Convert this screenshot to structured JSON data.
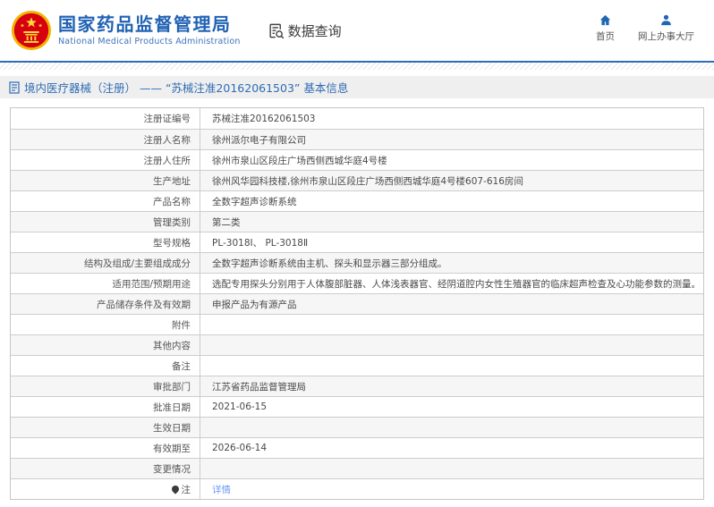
{
  "header": {
    "title": "国家药品监督管理局",
    "subtitle": "National Medical Products Administration",
    "data_query": "数据查询",
    "nav": [
      {
        "label": "首页",
        "icon": "home-icon"
      },
      {
        "label": "网上办事大厅",
        "icon": "person-icon"
      }
    ]
  },
  "breadcrumb": {
    "text": "境内医疗器械（注册） ——  “苏械注准20162061503”  基本信息",
    "icon": "document-icon"
  },
  "table": {
    "rows": [
      {
        "label": "注册证编号",
        "value": "苏械注准20162061503"
      },
      {
        "label": "注册人名称",
        "value": "徐州派尔电子有限公司"
      },
      {
        "label": "注册人住所",
        "value": "徐州市泉山区段庄广场西侧西城华庭4号楼"
      },
      {
        "label": "生产地址",
        "value": "徐州风华园科技楼,徐州市泉山区段庄广场西侧西城华庭4号楼607-616房间"
      },
      {
        "label": "产品名称",
        "value": "全数字超声诊断系统"
      },
      {
        "label": "管理类别",
        "value": "第二类"
      },
      {
        "label": "型号规格",
        "value": "PL-3018Ⅰ、 PL-3018Ⅱ"
      },
      {
        "label": "结构及组成/主要组成成分",
        "value": "全数字超声诊断系统由主机、探头和显示器三部分组成。"
      },
      {
        "label": "适用范围/预期用途",
        "value": "选配专用探头分别用于人体腹部脏器、人体浅表器官、经阴道腔内女性生殖器官的临床超声检查及心功能参数的测量。"
      },
      {
        "label": "产品储存条件及有效期",
        "value": "申报产品为有源产品"
      },
      {
        "label": "附件",
        "value": ""
      },
      {
        "label": "其他内容",
        "value": ""
      },
      {
        "label": "备注",
        "value": ""
      },
      {
        "label": "审批部门",
        "value": "江苏省药品监督管理局"
      },
      {
        "label": "批准日期",
        "value": "2021-06-15"
      },
      {
        "label": "生效日期",
        "value": ""
      },
      {
        "label": "有效期至",
        "value": "2026-06-14"
      },
      {
        "label": "变更情况",
        "value": ""
      },
      {
        "label": "注",
        "value": "详情",
        "label_icon": "note-pin-icon",
        "value_link": true
      }
    ]
  },
  "icons": {
    "emblem": "national-emblem",
    "data_query": "doc-magnifier",
    "home": "house",
    "online_hall": "person",
    "breadcrumb": "document-page",
    "note": "pin"
  },
  "colors": {
    "brand_blue": "#2062b4",
    "line_blue": "#2e6cb5",
    "nav_icon_blue": "#1f66b5",
    "link_blue": "#6b9cf5",
    "stripe_gray": "#f6f6f6",
    "bar_gray": "#efefef",
    "emblem_red": "#d6000f",
    "emblem_gold": "#f0b400"
  }
}
